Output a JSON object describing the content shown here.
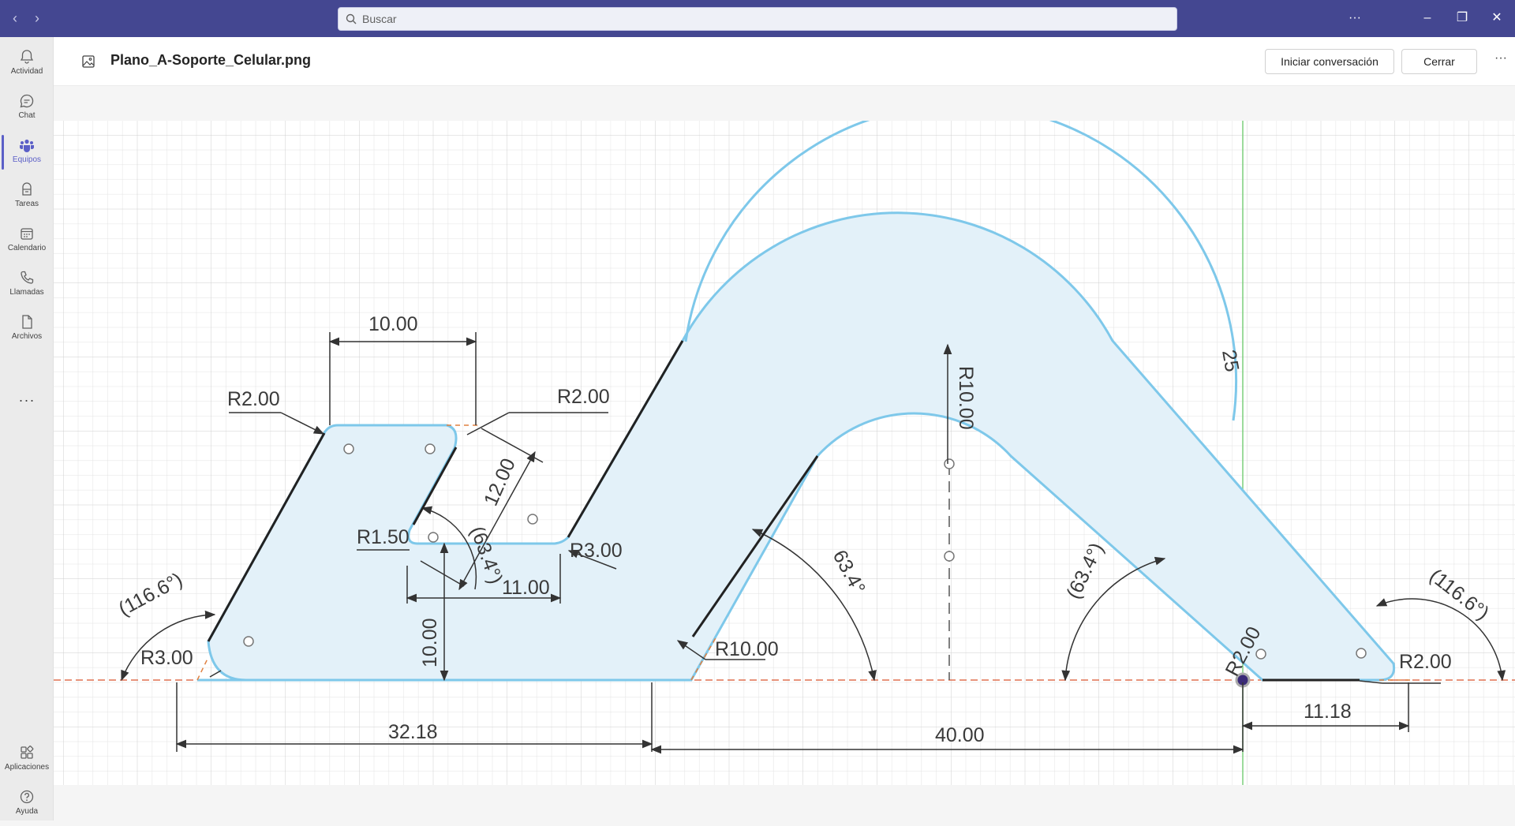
{
  "titlebar": {
    "search_placeholder": "Buscar",
    "more_label": "···",
    "color": "#444791"
  },
  "rail": {
    "items": [
      {
        "label": "Actividad",
        "icon": "bell-icon"
      },
      {
        "label": "Chat",
        "icon": "chat-icon"
      },
      {
        "label": "Equipos",
        "icon": "teams-icon",
        "active": true
      },
      {
        "label": "Tareas",
        "icon": "tasks-icon"
      },
      {
        "label": "Calendario",
        "icon": "calendar-icon"
      },
      {
        "label": "Llamadas",
        "icon": "phone-icon"
      },
      {
        "label": "Archivos",
        "icon": "file-icon"
      }
    ],
    "more_label": "···",
    "bottom": [
      {
        "label": "Aplicaciones",
        "icon": "apps-icon"
      },
      {
        "label": "Ayuda",
        "icon": "help-icon"
      }
    ]
  },
  "header": {
    "file_name": "Plano_A-Soporte_Celular.png",
    "start_chat_label": "Iniciar conversación",
    "close_label": "Cerrar",
    "more_label": "···"
  },
  "drawing": {
    "dimensions": {
      "width_top": "10.00",
      "radius_top_left": "R2.00",
      "radius_top_right": "R2.00",
      "slot_length": "12.00",
      "slot_angle": "(63.4°)",
      "radius_inner": "R1.50",
      "radius_valley": "R3.00",
      "valley_width": "11.00",
      "valley_height": "10.00",
      "left_angle": "(116.6°)",
      "radius_bottom_left": "R3.00",
      "overall_left": "32.18",
      "overall_right": "40.00",
      "radius_arch_outer": "R10.00",
      "radius_arch_inner": "R10.00",
      "arch_angle": "63.4°",
      "arch_angle_right": "(63.4°)",
      "side_length": "25",
      "right_angle": "(116.6°)",
      "radius_bottom_right": "R2.00",
      "radius_small": "R2.00",
      "foot_width": "11.18"
    },
    "colors": {
      "profile": "#7ec8ea",
      "fill": "#e3f1f9",
      "grid": "#dddddd",
      "axis_red": "#e07050",
      "axis_green": "#7ccf7c",
      "dim_line": "#333333"
    }
  }
}
